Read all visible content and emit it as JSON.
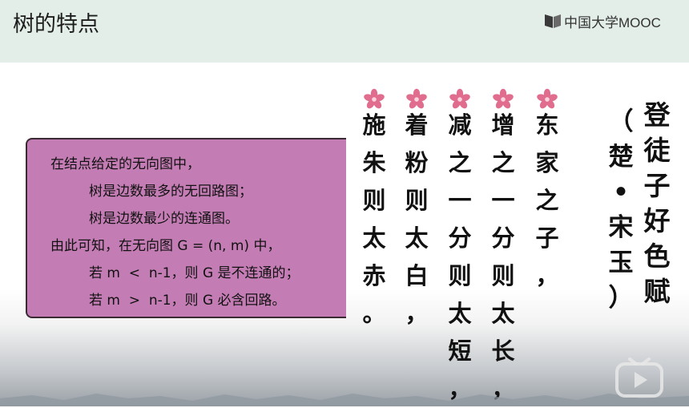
{
  "header": {
    "title": "树的特点",
    "logo_text": "中国大学MOOC"
  },
  "panel": {
    "lines": [
      "在结点给定的无向图中，",
      "树是边数最多的无回路图；",
      "树是边数最少的连通图。",
      "由此可知，在无向图 G = (n, m) 中，",
      "若 m  <  n-1，则 G 是不连通的；",
      "若 m  >  n-1，则 G 必含回路。"
    ]
  },
  "poem": {
    "title": [
      "登",
      "徒",
      "子",
      "好",
      "色",
      "赋"
    ],
    "author": [
      "（",
      "楚",
      "•",
      "宋",
      "玉",
      "）"
    ],
    "columns": [
      [
        "东",
        "家",
        "之",
        "子",
        "，"
      ],
      [
        "增",
        "之",
        "一",
        "分",
        "则",
        "太",
        "长",
        "，"
      ],
      [
        "减",
        "之",
        "一",
        "分",
        "则",
        "太",
        "短",
        "，"
      ],
      [
        "着",
        "粉",
        "则",
        "太",
        "白",
        "，"
      ],
      [
        "施",
        "朱",
        "则",
        "太",
        "赤",
        "。"
      ]
    ]
  },
  "colors": {
    "header_bg": "#e3eee8",
    "panel_bg": "#c47db4",
    "flower": "#e06d8e"
  },
  "icons": [
    "mooc-logo-icon",
    "flower-icon",
    "play-icon"
  ]
}
